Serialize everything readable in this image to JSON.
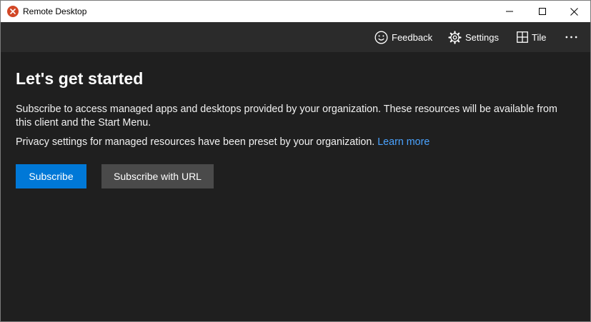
{
  "window": {
    "title": "Remote Desktop"
  },
  "toolbar": {
    "feedback_label": "Feedback",
    "settings_label": "Settings",
    "tile_label": "Tile",
    "more_label": "···"
  },
  "main": {
    "heading": "Let's get started",
    "description": "Subscribe to access managed apps and desktops provided by your organization. These resources will be available from this client and the Start Menu.",
    "privacy_text": "Privacy settings for managed resources have been preset by your organization.",
    "learn_more_link": "Learn more",
    "subscribe_button": "Subscribe",
    "subscribe_url_button": "Subscribe with URL"
  },
  "icons": {
    "app": "remote-desktop-icon",
    "feedback": "smiley-icon",
    "settings": "gear-icon",
    "tile": "grid-icon",
    "more": "ellipsis-icon"
  },
  "colors": {
    "background": "#1f1f1f",
    "toolbar": "#2b2b2b",
    "accent": "#0078d7",
    "link": "#4aa3ff",
    "secondary_button": "#4a4a4a",
    "app_icon": "#d24726"
  }
}
